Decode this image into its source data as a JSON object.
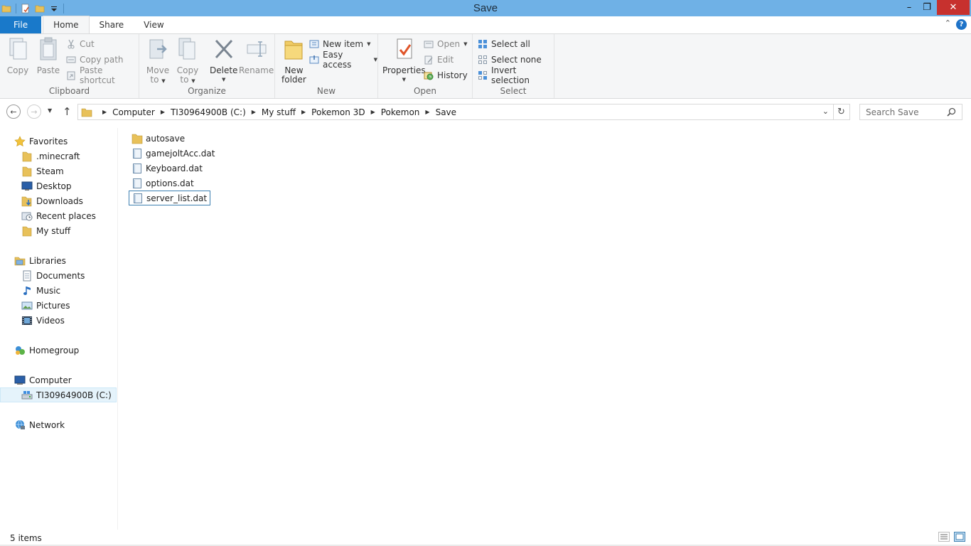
{
  "window": {
    "title": "Save",
    "minimize": "–",
    "restore": "❐",
    "close": "✕"
  },
  "ribbon_tabs": [
    "File",
    "Home",
    "Share",
    "View"
  ],
  "ribbon": {
    "clipboard": {
      "label": "Clipboard",
      "copy": "Copy",
      "paste": "Paste",
      "cut": "Cut",
      "copy_path": "Copy path",
      "paste_shortcut": "Paste shortcut"
    },
    "organize": {
      "label": "Organize",
      "move_to": [
        "Move",
        "to"
      ],
      "copy_to": [
        "Copy",
        "to"
      ],
      "delete": "Delete",
      "rename": "Rename"
    },
    "new": {
      "label": "New",
      "new_folder": [
        "New",
        "folder"
      ],
      "new_item": "New item",
      "easy_access": "Easy access"
    },
    "open": {
      "label": "Open",
      "properties": "Properties",
      "open": "Open",
      "edit": "Edit",
      "history": "History"
    },
    "select": {
      "label": "Select",
      "select_all": "Select all",
      "select_none": "Select none",
      "invert_selection": "Invert selection"
    }
  },
  "address": {
    "breadcrumbs": [
      "Computer",
      "TI30964900B (C:)",
      "My stuff",
      "Pokemon 3D",
      "Pokemon",
      "Save"
    ]
  },
  "search": {
    "placeholder": "Search Save"
  },
  "nav": {
    "favorites": {
      "label": "Favorites",
      "items": [
        ".minecraft",
        "Steam",
        "Desktop",
        "Downloads",
        "Recent places",
        "My stuff"
      ]
    },
    "libraries": {
      "label": "Libraries",
      "items": [
        "Documents",
        "Music",
        "Pictures",
        "Videos"
      ]
    },
    "homegroup": "Homegroup",
    "computer": {
      "label": "Computer",
      "items": [
        "TI30964900B (C:)"
      ]
    },
    "network": "Network"
  },
  "files": [
    {
      "name": "autosave",
      "type": "folder"
    },
    {
      "name": "gamejoltAcc.dat",
      "type": "file"
    },
    {
      "name": "Keyboard.dat",
      "type": "file"
    },
    {
      "name": "options.dat",
      "type": "file"
    },
    {
      "name": "server_list.dat",
      "type": "file",
      "selected": true
    }
  ],
  "status": {
    "item_count": "5 items"
  },
  "colors": {
    "titlebar": "#6fb1e6",
    "file_tab": "#1979ca",
    "close_button": "#c7312e",
    "selection_border": "#3c7fb1",
    "folder": "#e8c15a"
  }
}
